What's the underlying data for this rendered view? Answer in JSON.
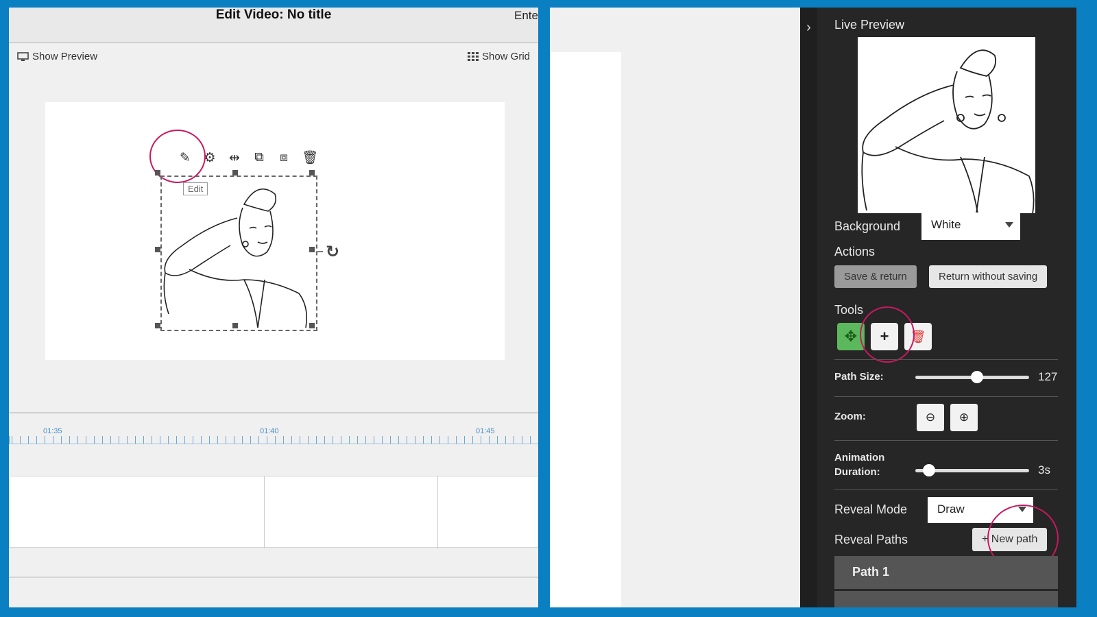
{
  "left": {
    "title": "Edit Video: No title",
    "title_right": "Ente",
    "show_preview": "Show Preview",
    "show_grid": "Show Grid",
    "tooltip": "Edit",
    "timeline_labels": [
      "01:35",
      "01:40",
      "01:45"
    ]
  },
  "right": {
    "live_preview": "Live Preview",
    "background_label": "Background",
    "background_value": "White",
    "actions_label": "Actions",
    "save_return": "Save & return",
    "return_without_saving": "Return without saving",
    "tools_label": "Tools",
    "path_size_label": "Path Size:",
    "path_size_value": "127",
    "zoom_label": "Zoom:",
    "animation_duration_label": "Animation Duration:",
    "animation_duration_value": "3s",
    "reveal_mode_label": "Reveal Mode",
    "reveal_mode_value": "Draw",
    "reveal_paths_label": "Reveal Paths",
    "new_path": "New path",
    "path_item": "Path 1"
  },
  "colors": {
    "frame": "#0a7fc2",
    "highlight": "#c8195f",
    "tool_active": "#5cb85c",
    "tool_delete": "#e53935"
  }
}
